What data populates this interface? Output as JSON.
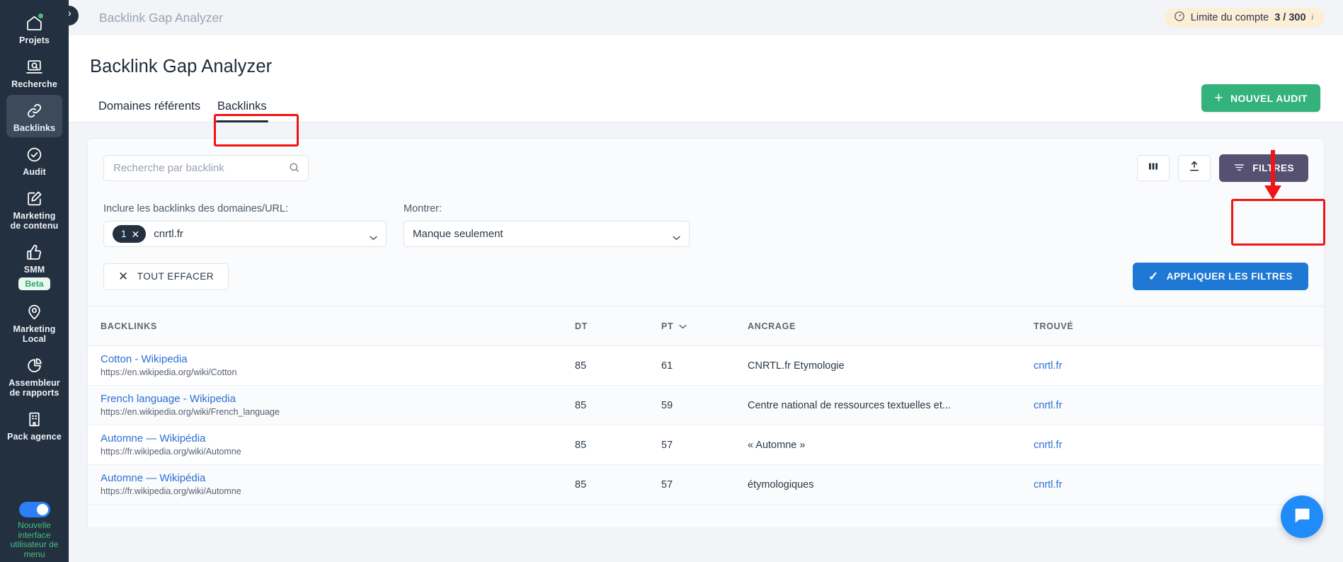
{
  "sidebar": {
    "items": [
      {
        "label": "Projets",
        "icon": "home-icon",
        "active": false,
        "dot": true
      },
      {
        "label": "Recherche",
        "icon": "search-laptop-icon",
        "active": false,
        "dot": false
      },
      {
        "label": "Backlinks",
        "icon": "link-icon",
        "active": true,
        "dot": false
      },
      {
        "label": "Audit",
        "icon": "check-circle-icon",
        "active": false,
        "dot": false
      },
      {
        "label": "Marketing de contenu",
        "icon": "pencil-square-icon",
        "active": false,
        "dot": false
      },
      {
        "label": "SMM",
        "icon": "thumbs-up-icon",
        "active": false,
        "dot": false,
        "badge": "Beta"
      },
      {
        "label": "Marketing Local",
        "icon": "map-pin-icon",
        "active": false,
        "dot": false
      },
      {
        "label": "Assembleur de rapports",
        "icon": "pie-chart-icon",
        "active": false,
        "dot": false
      },
      {
        "label": "Pack agence",
        "icon": "building-icon",
        "active": false,
        "dot": false
      }
    ],
    "toggle": {
      "label": "Nouvelle interface utilisateur de menu",
      "on": true,
      "color": "#46c07c"
    }
  },
  "topbar": {
    "collapse_icon": "chevron-right-icon",
    "breadcrumb": "Backlink Gap Analyzer",
    "account_limit": {
      "icon": "gauge-icon",
      "label": "Limite du compte",
      "value": "3 / 300",
      "info": "i",
      "bg": "#fdeed8"
    }
  },
  "page": {
    "title": "Backlink Gap Analyzer",
    "tabs": [
      {
        "label": "Domaines référents",
        "active": false
      },
      {
        "label": "Backlinks",
        "active": true
      }
    ],
    "new_audit_button": {
      "label": "NOUVEL AUDIT",
      "icon": "plus-icon",
      "color": "#33b27b"
    }
  },
  "toolbar": {
    "search_placeholder": "Recherche par backlink",
    "search_value": "",
    "search_icon": "search-icon",
    "columns_button_icon": "columns-icon",
    "export_button_icon": "upload-icon",
    "filters_button": {
      "label": "FILTRES",
      "icon": "filter-icon",
      "color": "#565071"
    }
  },
  "filters": {
    "domains": {
      "label": "Inclure les backlinks des domaines/URL:",
      "chip_count": "1",
      "chip_remove_icon": "close-icon",
      "value": "cnrtl.fr",
      "caret_icon": "chevron-down-icon"
    },
    "show": {
      "label": "Montrer:",
      "value": "Manque seulement",
      "caret_icon": "chevron-down-icon"
    },
    "clear_all_button": {
      "label": "TOUT EFFACER",
      "icon": "close-icon"
    },
    "apply_button": {
      "label": "APPLIQUER LES FILTRES",
      "icon": "check-icon",
      "color": "#1f79d4"
    }
  },
  "table": {
    "columns": [
      {
        "label": "BACKLINKS",
        "sortable": false
      },
      {
        "label": "DT",
        "sortable": false
      },
      {
        "label": "PT",
        "sortable": true,
        "sort_icon": "chevron-down-icon"
      },
      {
        "label": "ANCRAGE",
        "sortable": false
      },
      {
        "label": "TROUVÉ",
        "sortable": false
      }
    ],
    "rows": [
      {
        "title": "Cotton - Wikipedia",
        "url": "https://en.wikipedia.org/wiki/Cotton",
        "dt": "85",
        "pt": "61",
        "anchor": "CNRTL.fr Etymologie",
        "found": "cnrtl.fr"
      },
      {
        "title": "French language - Wikipedia",
        "url": "https://en.wikipedia.org/wiki/French_language",
        "dt": "85",
        "pt": "59",
        "anchor": "Centre national de ressources textuelles et...",
        "found": "cnrtl.fr"
      },
      {
        "title": "Automne — Wikipédia",
        "url": "https://fr.wikipedia.org/wiki/Automne",
        "dt": "85",
        "pt": "57",
        "anchor": "« Automne »",
        "found": "cnrtl.fr"
      },
      {
        "title": "Automne — Wikipédia",
        "url": "https://fr.wikipedia.org/wiki/Automne",
        "dt": "85",
        "pt": "57",
        "anchor": "étymologiques",
        "found": "cnrtl.fr"
      }
    ]
  },
  "chat": {
    "icon": "chat-bubble-icon",
    "color": "#1f8cf9"
  },
  "annotations": {
    "color": "#f01414"
  }
}
